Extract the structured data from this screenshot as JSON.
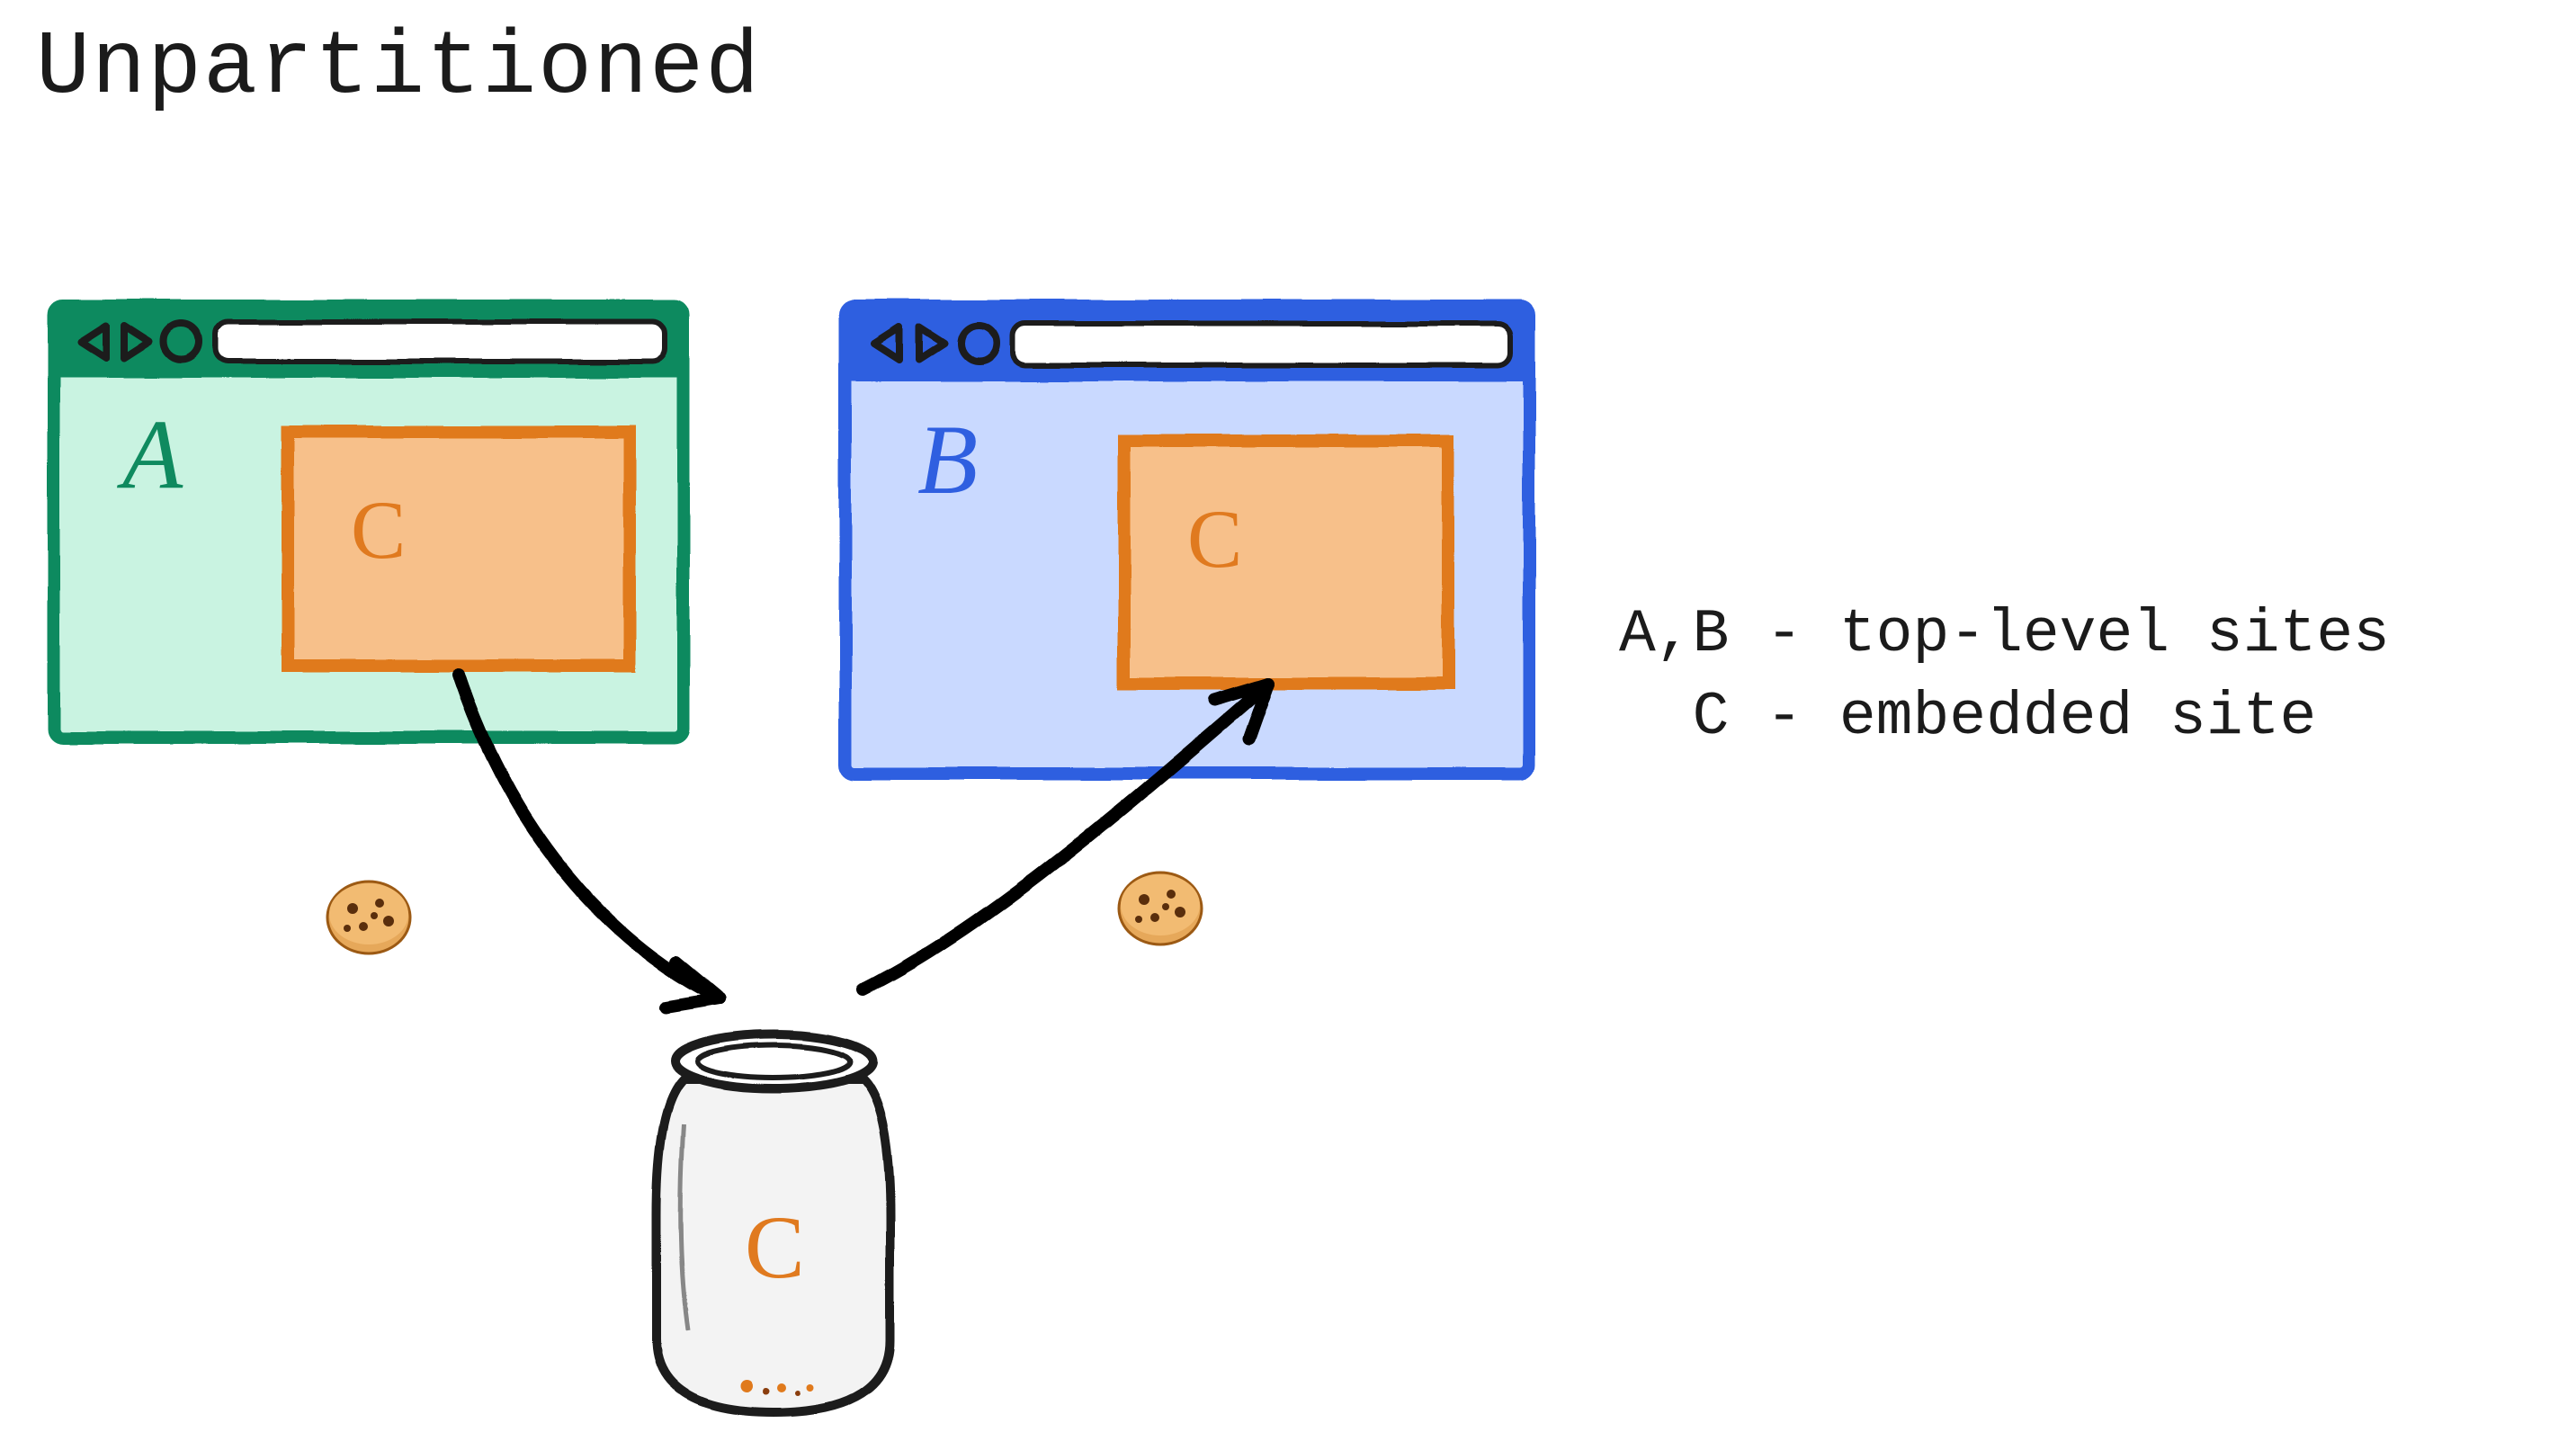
{
  "title": "Unpartitioned",
  "legend": {
    "line1": "A,B - top-level sites",
    "line2": "  C - embedded site"
  },
  "browsers": {
    "a": {
      "site_label": "A",
      "embed_label": "C"
    },
    "b": {
      "site_label": "B",
      "embed_label": "C"
    }
  },
  "jar": {
    "label": "C"
  },
  "colors": {
    "green_stroke": "#0f8a5f",
    "green_fill": "#c9f3e1",
    "blue_stroke": "#2f5fe0",
    "blue_fill": "#c9d9ff",
    "orange_stroke": "#e07a1f",
    "orange_fill": "#f7c08a",
    "ink": "#1b1b1b"
  }
}
